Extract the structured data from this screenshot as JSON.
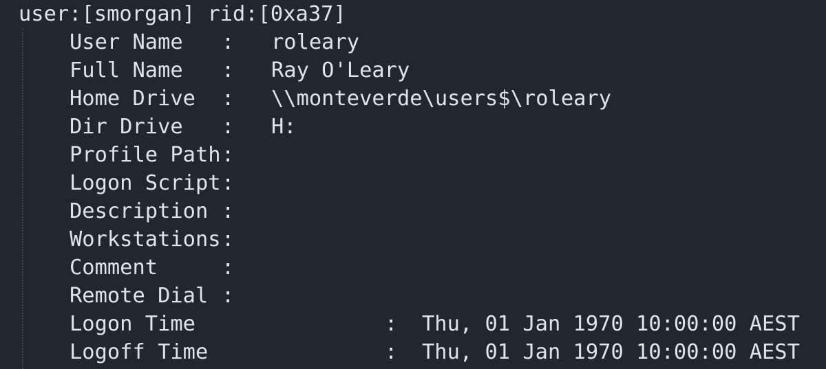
{
  "header": {
    "text": "user:[smorgan] rid:[0xa37]"
  },
  "fields": [
    {
      "label": "User Name",
      "colon": ":",
      "value": "roleary"
    },
    {
      "label": "Full Name",
      "colon": ":",
      "value": "Ray O'Leary"
    },
    {
      "label": "Home Drive",
      "colon": ":",
      "value": "\\\\monteverde\\users$\\roleary"
    },
    {
      "label": "Dir Drive",
      "colon": ":",
      "value": "H:"
    },
    {
      "label": "Profile Path",
      "colon": ":",
      "value": ""
    },
    {
      "label": "Logon Script",
      "colon": ":",
      "value": ""
    },
    {
      "label": "Description",
      "colon": ":",
      "value": ""
    },
    {
      "label": "Workstations",
      "colon": ":",
      "value": ""
    },
    {
      "label": "Comment",
      "colon": ":",
      "value": ""
    },
    {
      "label": "Remote Dial",
      "colon": ":",
      "value": ""
    }
  ],
  "times": [
    {
      "label": "Logon Time",
      "colon": ":",
      "value": "Thu, 01 Jan 1970 10:00:00 AEST"
    },
    {
      "label": "Logoff Time",
      "colon": ":",
      "value": "Thu, 01 Jan 1970 10:00:00 AEST"
    }
  ],
  "colors": {
    "background": "#22272e",
    "text": "#dfe4ea",
    "indent_guide": "#3d444d"
  }
}
